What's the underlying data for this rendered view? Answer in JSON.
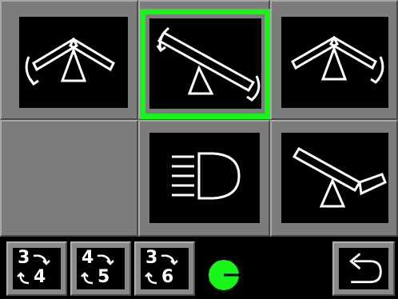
{
  "tiles": [
    {
      "id": "tilt-both-up",
      "icon": "tilt-both-up-icon",
      "selected": false
    },
    {
      "id": "tilt-left-down",
      "icon": "tilt-rotate-icon",
      "selected": true
    },
    {
      "id": "tilt-right-up",
      "icon": "tilt-right-up-icon",
      "selected": false
    },
    {
      "id": "headlight",
      "icon": "headlight-icon",
      "selected": false
    },
    {
      "id": "tilt-fold",
      "icon": "tilt-fold-icon",
      "selected": false
    }
  ],
  "gear_buttons": [
    {
      "from": "3",
      "to": "4"
    },
    {
      "from": "4",
      "to": "5"
    },
    {
      "from": "3",
      "to": "6"
    }
  ],
  "colors": {
    "selected": "#17f51b",
    "indicator": "#17f51b",
    "panel": "#7c7c7c"
  },
  "back_icon": "return-arrow-icon",
  "indicator_icon": "green-circle-arrow-icon"
}
